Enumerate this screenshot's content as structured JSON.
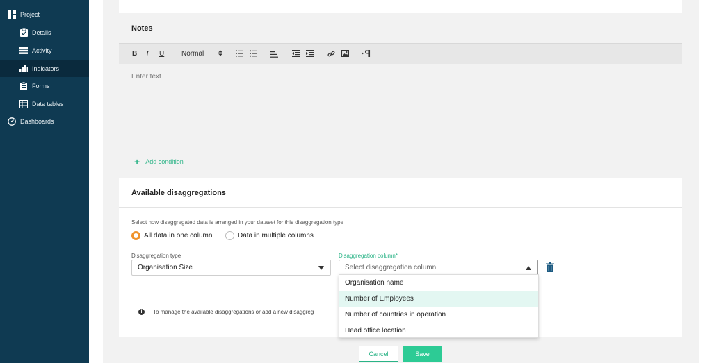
{
  "sidebar": {
    "items": [
      {
        "label": "Project",
        "icon": "project-icon"
      },
      {
        "label": "Details",
        "icon": "clipboard-icon"
      },
      {
        "label": "Activity",
        "icon": "activity-icon"
      },
      {
        "label": "Indicators",
        "icon": "bar-chart-icon"
      },
      {
        "label": "Forms",
        "icon": "form-icon"
      },
      {
        "label": "Data tables",
        "icon": "table-icon"
      },
      {
        "label": "Dashboards",
        "icon": "dashboard-icon"
      }
    ],
    "active": "Indicators"
  },
  "notes": {
    "title": "Notes",
    "toolbar": {
      "bold": "B",
      "italic": "I",
      "underline": "U",
      "format": "Normal"
    },
    "placeholder": "Enter text"
  },
  "add_condition": "Add condition",
  "disaggregations": {
    "title": "Available disaggregations",
    "helper": "Select how disaggregated data is arranged in your dataset for this disaggregation type",
    "radio_one": "All data in one column",
    "radio_multi": "Data in multiple columns",
    "type_label": "Disaggregation type",
    "type_value": "Organisation Size",
    "column_label": "Disaggregation column*",
    "column_placeholder": "Select disaggregation column",
    "options": [
      "Organisation name",
      "Number of Employees",
      "Number of countries in operation",
      "Head office location"
    ],
    "info": "To manage the available disaggregations or add a new disaggreg"
  },
  "buttons": {
    "cancel": "Cancel",
    "save": "Save"
  },
  "colors": {
    "sidebar": "#0f3a52",
    "accent": "#2ab386",
    "radio": "#f0932b"
  }
}
